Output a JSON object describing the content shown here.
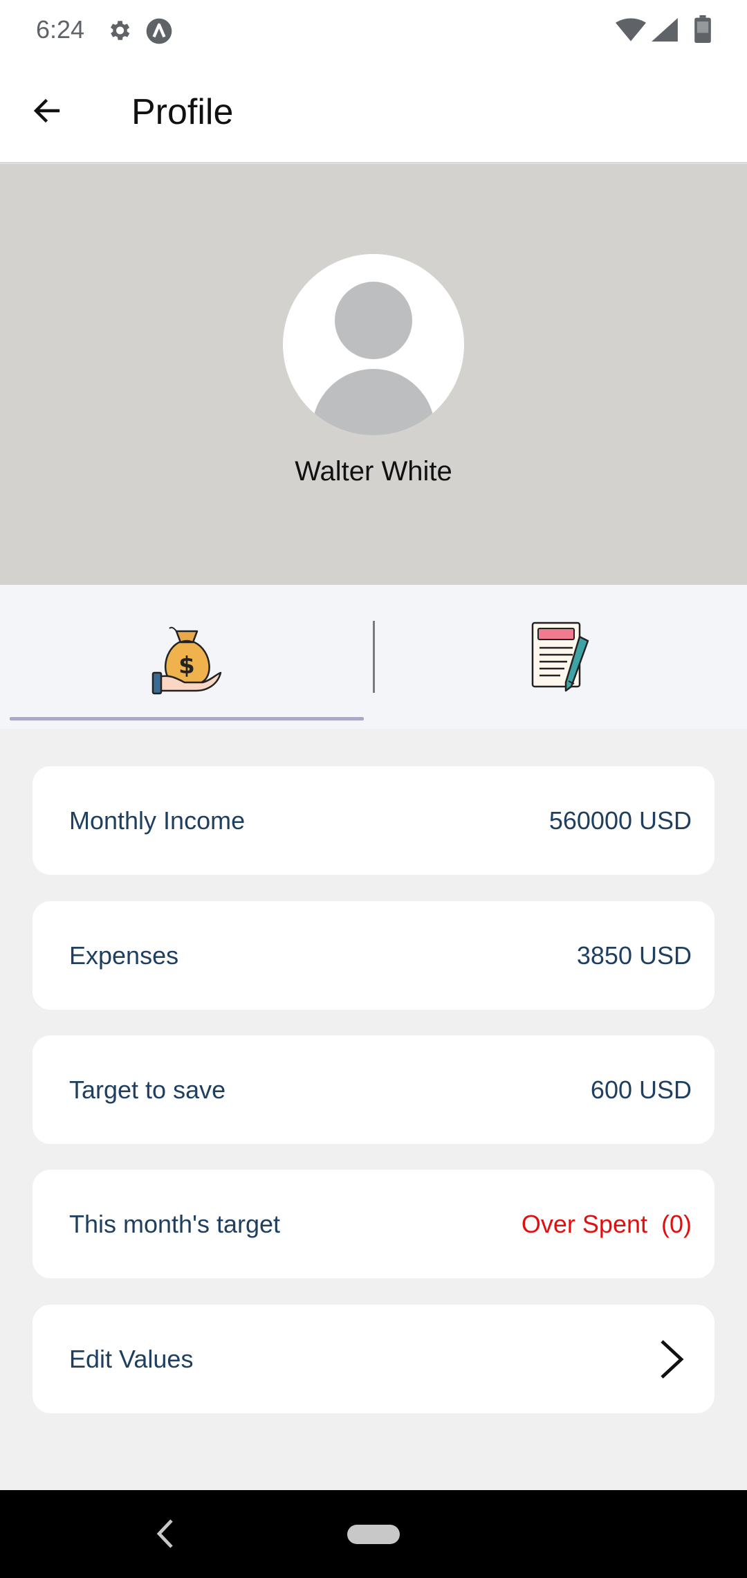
{
  "status_bar": {
    "time": "6:24",
    "icons": [
      "gear-icon",
      "a-icon",
      "wifi-icon",
      "signal-icon",
      "battery-icon"
    ]
  },
  "app_bar": {
    "back_icon": "arrow-left-icon",
    "title": "Profile"
  },
  "profile": {
    "avatar_icon": "default-avatar-icon",
    "name": "Walter White"
  },
  "tabs": [
    {
      "icon": "money-bag-hand-icon",
      "selected": true
    },
    {
      "icon": "document-pen-icon",
      "selected": false
    }
  ],
  "cards": {
    "monthly_income": {
      "label": "Monthly Income",
      "value": "560000 USD"
    },
    "expenses": {
      "label": "Expenses",
      "value": "3850 USD"
    },
    "target_to_save": {
      "label": "Target to save",
      "value": "600 USD"
    },
    "this_month_target": {
      "label": "This month's target",
      "value": "Over Spent  (0)"
    },
    "edit_values": {
      "label": "Edit Values",
      "icon": "chevron-right-icon"
    }
  },
  "colors": {
    "header_bg": "#d3d2cf",
    "card_text": "#1f3f60",
    "alert": "#e0100f",
    "tab_indicator": "#a9a9c7"
  }
}
